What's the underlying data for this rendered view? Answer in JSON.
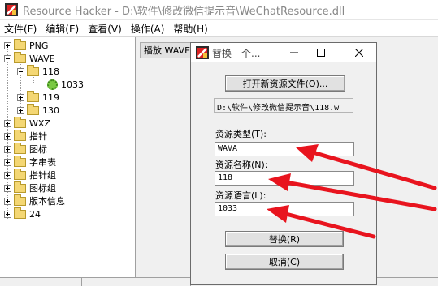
{
  "window": {
    "title": "Resource Hacker  -  D:\\软件\\修改微信提示音\\WeChatResource.dll"
  },
  "menu": [
    "文件(F)",
    "编辑(E)",
    "查看(V)",
    "操作(A)",
    "帮助(H)"
  ],
  "tree": [
    {
      "label": "PNG",
      "expander": "plus"
    },
    {
      "label": "WAVE",
      "expander": "minus"
    },
    {
      "label": "118",
      "expander": "minus"
    },
    {
      "label": "1033",
      "expander": "none"
    },
    {
      "label": "119",
      "expander": "plus"
    },
    {
      "label": "130",
      "expander": "plus"
    },
    {
      "label": "WXZ",
      "expander": "plus"
    },
    {
      "label": "指针",
      "expander": "plus"
    },
    {
      "label": "图标",
      "expander": "plus"
    },
    {
      "label": "字串表",
      "expander": "plus"
    },
    {
      "label": "指针组",
      "expander": "plus"
    },
    {
      "label": "图标组",
      "expander": "plus"
    },
    {
      "label": "版本信息",
      "expander": "plus"
    },
    {
      "label": "24",
      "expander": "plus"
    }
  ],
  "toolbar": {
    "play_label": "播放 WAVE"
  },
  "dialog": {
    "title": "替换一个...",
    "open_button": "打开新资源文件(O)...",
    "file_path": "D:\\软件\\修改微信提示音\\118.w",
    "type_label": "资源类型(T):",
    "type_value": "WAVA",
    "name_label": "资源名称(N):",
    "name_value": "118",
    "lang_label": "资源语言(L):",
    "lang_value": "1033",
    "replace_button": "替换(R)",
    "cancel_button": "取消(C)"
  },
  "colors": {
    "annotation_arrow": "#e8141e"
  }
}
